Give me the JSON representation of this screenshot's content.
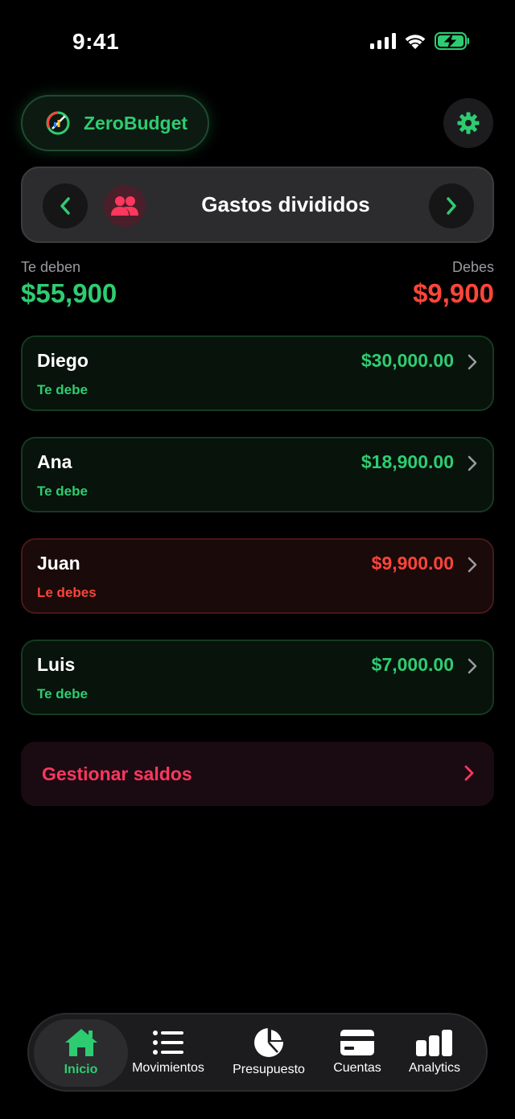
{
  "status_bar": {
    "time": "9:41"
  },
  "header": {
    "app_name": "ZeroBudget"
  },
  "section": {
    "title": "Gastos divididos"
  },
  "totals": {
    "owed_to_you_label": "Te deben",
    "owed_to_you_value": "$55,900",
    "you_owe_label": "Debes",
    "you_owe_value": "$9,900"
  },
  "people": [
    {
      "name": "Diego",
      "amount": "$30,000.00",
      "status": "Te debe"
    },
    {
      "name": "Ana",
      "amount": "$18,900.00",
      "status": "Te debe"
    },
    {
      "name": "Juan",
      "amount": "$9,900.00",
      "status": "Le debes"
    },
    {
      "name": "Luis",
      "amount": "$7,000.00",
      "status": "Te debe"
    }
  ],
  "manage": {
    "label": "Gestionar saldos"
  },
  "tabs": [
    {
      "label": "Inicio",
      "icon": "home-icon",
      "active": true
    },
    {
      "label": "Movimientos",
      "icon": "list-icon",
      "active": false
    },
    {
      "label": "Presupuesto",
      "icon": "pie-chart-icon",
      "active": false
    },
    {
      "label": "Cuentas",
      "icon": "card-icon",
      "active": false
    },
    {
      "label": "Analytics",
      "icon": "bar-chart-icon",
      "active": false
    }
  ],
  "colors": {
    "positive": "#2ecc71",
    "negative": "#ff453a",
    "accent_pink": "#ff375f",
    "background": "#000000"
  }
}
